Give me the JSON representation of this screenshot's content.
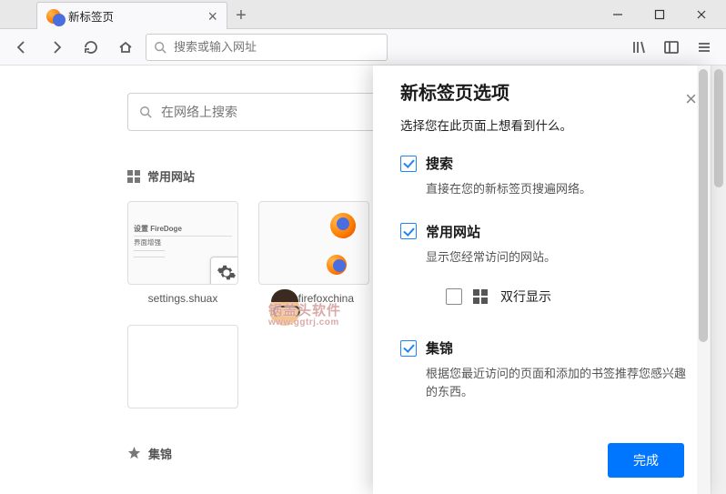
{
  "titlebar": {
    "minimize": "—",
    "maximize": "▢",
    "close": "✕"
  },
  "tab": {
    "title": "新标签页"
  },
  "toolbar": {
    "url_placeholder": "搜索或输入网址"
  },
  "newtab": {
    "search_placeholder": "在网络上搜索",
    "top_sites_header": "常用网站",
    "highlights_header": "集锦",
    "tiles": [
      {
        "caption": "settings.shuax"
      },
      {
        "caption": "start.firefoxchina"
      },
      {
        "caption": ""
      },
      {
        "caption": ""
      }
    ]
  },
  "watermark": {
    "text": "锅盖头软件",
    "sub": "www.ggtrj.com"
  },
  "panel": {
    "title": "新标签页选项",
    "subtitle": "选择您在此页面上想看到什么。",
    "options": [
      {
        "title": "搜索",
        "desc": "直接在您的新标签页搜遍网络。",
        "checked": true
      },
      {
        "title": "常用网站",
        "desc": "显示您经常访问的网站。",
        "checked": true,
        "subrow": {
          "label": "双行显示",
          "checked": false
        }
      },
      {
        "title": "集锦",
        "desc": "根据您最近访问的页面和添加的书签推荐您感兴趣的东西。",
        "checked": true
      }
    ],
    "done": "完成"
  }
}
